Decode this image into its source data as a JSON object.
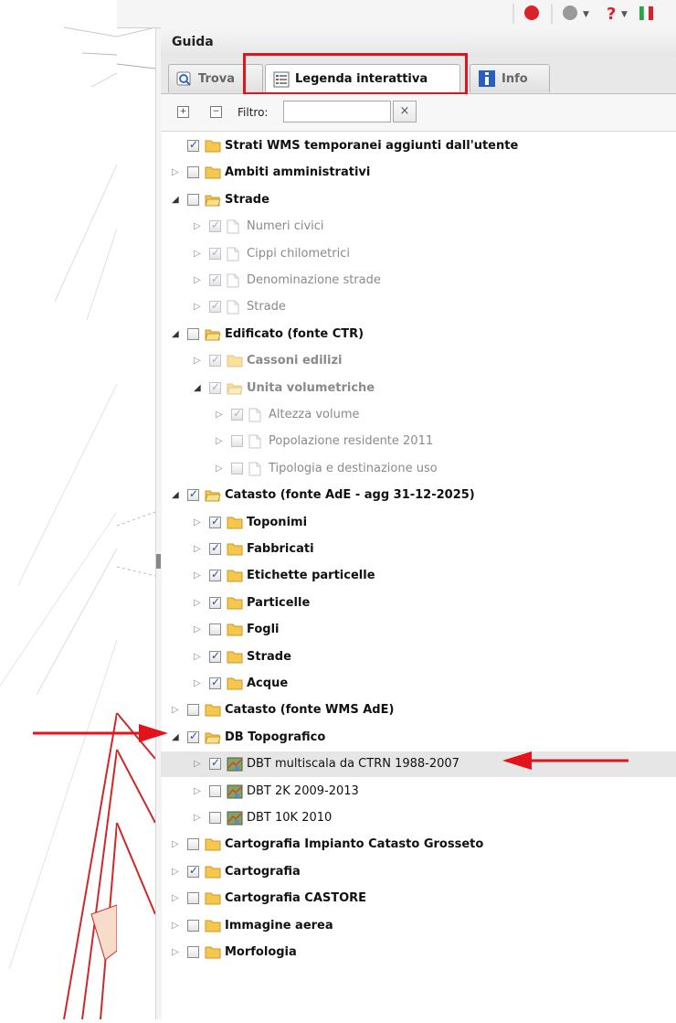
{
  "header": {
    "title": "Guida"
  },
  "tabs": [
    {
      "label": "Trova",
      "icon": "search-icon"
    },
    {
      "label": "Legenda interattiva",
      "icon": "legend-icon"
    },
    {
      "label": "Info",
      "icon": "info-icon"
    }
  ],
  "toolbar": {
    "filter_label": "Filtro:",
    "filter_value": "",
    "clear_label": "×"
  },
  "colors": {
    "highlight": "#e3131b",
    "folder": "#f5c84c",
    "check": "#2a4fa5"
  },
  "tree": [
    {
      "label": "Strati WMS temporanei aggiunti dall'utente",
      "level": 0,
      "checked": true,
      "expander": "none",
      "icon": "folder",
      "style": "bold"
    },
    {
      "label": "Ambiti amministrativi",
      "level": 0,
      "checked": false,
      "expander": "collapsed",
      "icon": "folder",
      "style": "bold"
    },
    {
      "label": "Strade",
      "level": 0,
      "checked": false,
      "expander": "expanded",
      "icon": "folder-open",
      "style": "bold"
    },
    {
      "label": "Numeri civici",
      "level": 1,
      "checked": true,
      "expander": "collapsed",
      "icon": "file",
      "style": "gray",
      "dim": true
    },
    {
      "label": "Cippi chilometrici",
      "level": 1,
      "checked": true,
      "expander": "collapsed",
      "icon": "file",
      "style": "gray",
      "dim": true
    },
    {
      "label": "Denominazione strade",
      "level": 1,
      "checked": true,
      "expander": "collapsed",
      "icon": "file",
      "style": "gray",
      "dim": true
    },
    {
      "label": "Strade",
      "level": 1,
      "checked": true,
      "expander": "collapsed",
      "icon": "file",
      "style": "gray",
      "dim": true
    },
    {
      "label": "Edificato (fonte CTR)",
      "level": 0,
      "checked": false,
      "expander": "expanded",
      "icon": "folder-open",
      "style": "bold"
    },
    {
      "label": "Cassoni edilizi",
      "level": 1,
      "checked": true,
      "expander": "collapsed",
      "icon": "folder",
      "style": "grayb",
      "dim": true
    },
    {
      "label": "Unita volumetriche",
      "level": 1,
      "checked": true,
      "expander": "expanded",
      "icon": "folder-open",
      "style": "grayb",
      "dim": true
    },
    {
      "label": "Altezza volume",
      "level": 2,
      "checked": true,
      "expander": "collapsed",
      "icon": "file",
      "style": "gray",
      "dim": true
    },
    {
      "label": "Popolazione residente 2011",
      "level": 2,
      "checked": false,
      "expander": "collapsed",
      "icon": "file",
      "style": "gray",
      "dim": true
    },
    {
      "label": "Tipologia e destinazione uso",
      "level": 2,
      "checked": false,
      "expander": "collapsed",
      "icon": "file",
      "style": "gray",
      "dim": true
    },
    {
      "label": "Catasto (fonte AdE - agg 31-12-2025)",
      "level": 0,
      "checked": true,
      "expander": "expanded",
      "icon": "folder-open",
      "style": "bold"
    },
    {
      "label": "Toponimi",
      "level": 1,
      "checked": true,
      "expander": "collapsed",
      "icon": "folder",
      "style": "bold"
    },
    {
      "label": "Fabbricati",
      "level": 1,
      "checked": true,
      "expander": "collapsed",
      "icon": "folder",
      "style": "bold"
    },
    {
      "label": "Etichette particelle",
      "level": 1,
      "checked": true,
      "expander": "collapsed",
      "icon": "folder",
      "style": "bold"
    },
    {
      "label": "Particelle",
      "level": 1,
      "checked": true,
      "expander": "collapsed",
      "icon": "folder",
      "style": "bold"
    },
    {
      "label": "Fogli",
      "level": 1,
      "checked": false,
      "expander": "collapsed",
      "icon": "folder",
      "style": "bold"
    },
    {
      "label": "Strade",
      "level": 1,
      "checked": true,
      "expander": "collapsed",
      "icon": "folder",
      "style": "bold"
    },
    {
      "label": "Acque",
      "level": 1,
      "checked": true,
      "expander": "collapsed",
      "icon": "folder",
      "style": "bold"
    },
    {
      "label": "Catasto (fonte WMS AdE)",
      "level": 0,
      "checked": false,
      "expander": "collapsed",
      "icon": "folder",
      "style": "bold"
    },
    {
      "label": "DB Topografico",
      "level": 0,
      "checked": true,
      "expander": "expanded",
      "icon": "folder-open",
      "style": "bold"
    },
    {
      "label": "DBT multiscala da CTRN 1988-2007",
      "level": 1,
      "checked": true,
      "expander": "collapsed",
      "icon": "map",
      "style": "plain",
      "selected": true
    },
    {
      "label": "DBT 2K 2009-2013",
      "level": 1,
      "checked": false,
      "expander": "collapsed",
      "icon": "map",
      "style": "plain"
    },
    {
      "label": "DBT 10K 2010",
      "level": 1,
      "checked": false,
      "expander": "collapsed",
      "icon": "map",
      "style": "plain"
    },
    {
      "label": "Cartografia Impianto Catasto Grosseto",
      "level": 0,
      "checked": false,
      "expander": "collapsed",
      "icon": "folder",
      "style": "bold"
    },
    {
      "label": "Cartografia",
      "level": 0,
      "checked": true,
      "expander": "collapsed",
      "icon": "folder",
      "style": "bold"
    },
    {
      "label": "Cartografia CASTORE",
      "level": 0,
      "checked": false,
      "expander": "collapsed",
      "icon": "folder",
      "style": "bold"
    },
    {
      "label": "Immagine aerea",
      "level": 0,
      "checked": false,
      "expander": "collapsed",
      "icon": "folder",
      "style": "bold"
    },
    {
      "label": "Morfologia",
      "level": 0,
      "checked": false,
      "expander": "collapsed",
      "icon": "folder",
      "style": "bold"
    }
  ]
}
